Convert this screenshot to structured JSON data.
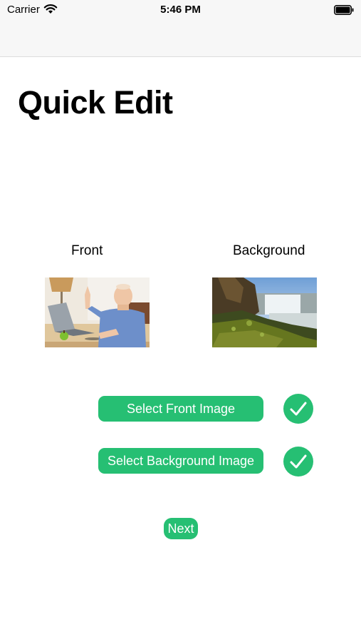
{
  "status_bar": {
    "carrier": "Carrier",
    "time": "5:46 PM",
    "wifi_icon": "wifi-icon",
    "battery_icon": "battery-icon"
  },
  "page": {
    "title": "Quick Edit"
  },
  "front": {
    "label": "Front",
    "button_label": "Select Front Image",
    "selected": true,
    "status_icon": "checkmark-icon"
  },
  "background": {
    "label": "Background",
    "button_label": "Select Background Image",
    "selected": true,
    "status_icon": "checkmark-icon"
  },
  "next_label": "Next",
  "colors": {
    "accent": "#26bf73",
    "bar_background": "#f7f7f7",
    "text": "#000000"
  }
}
